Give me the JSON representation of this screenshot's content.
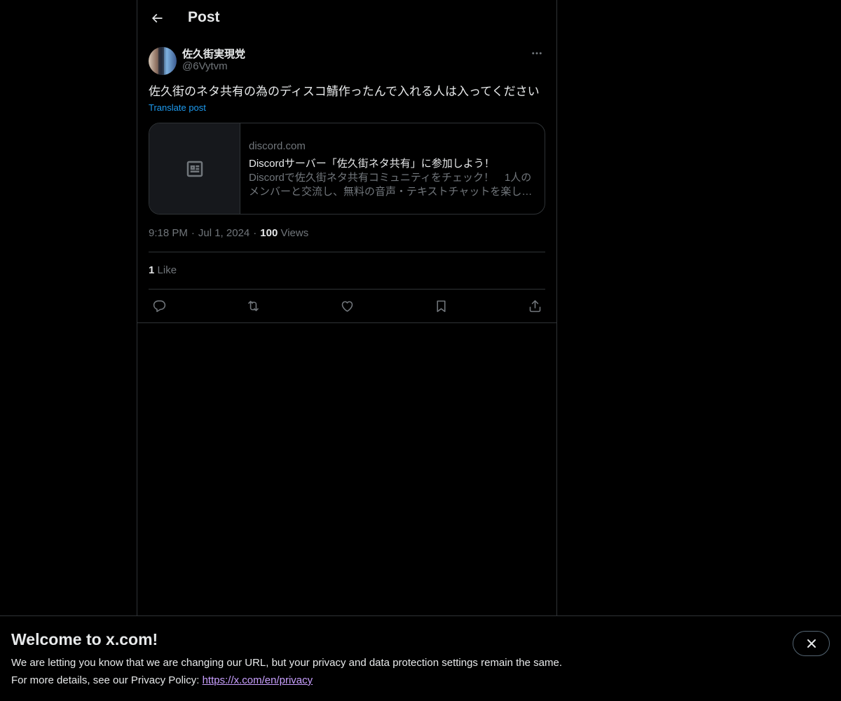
{
  "header": {
    "title": "Post"
  },
  "post": {
    "author": {
      "display_name": "佐久街実現党",
      "handle": "@6Vytvm"
    },
    "text": "佐久街のネタ共有の為のディスコ鯖作ったんで入れる人は入ってください",
    "translate_label": "Translate post",
    "card": {
      "domain": "discord.com",
      "title": "Discordサーバー「佐久街ネタ共有」に参加しよう！",
      "description": "Discordで佐久街ネタ共有コミュニティをチェック！　1人のメンバーと交流し、無料の音声・テキストチャットを楽しみましょう。"
    },
    "time": "9:18 PM",
    "date": "Jul 1, 2024",
    "views_count": "100",
    "views_label": "Views",
    "likes_count": "1",
    "likes_label": "Like"
  },
  "actions": [
    {
      "name": "reply",
      "icon": "reply-icon"
    },
    {
      "name": "repost",
      "icon": "repost-icon"
    },
    {
      "name": "like",
      "icon": "heart-icon"
    },
    {
      "name": "bookmark",
      "icon": "bookmark-icon"
    },
    {
      "name": "share",
      "icon": "share-icon"
    }
  ],
  "banner": {
    "title": "Welcome to x.com!",
    "line1": "We are letting you know that we are changing our URL, but your privacy and data protection settings remain the same.",
    "line2_prefix": "For more details, see our Privacy Policy: ",
    "link_text": "https://x.com/en/privacy"
  },
  "colors": {
    "background": "#000000",
    "text": "#e7e9ea",
    "muted": "#71767b",
    "accent": "#1d9bf0",
    "border": "#2f3336"
  }
}
